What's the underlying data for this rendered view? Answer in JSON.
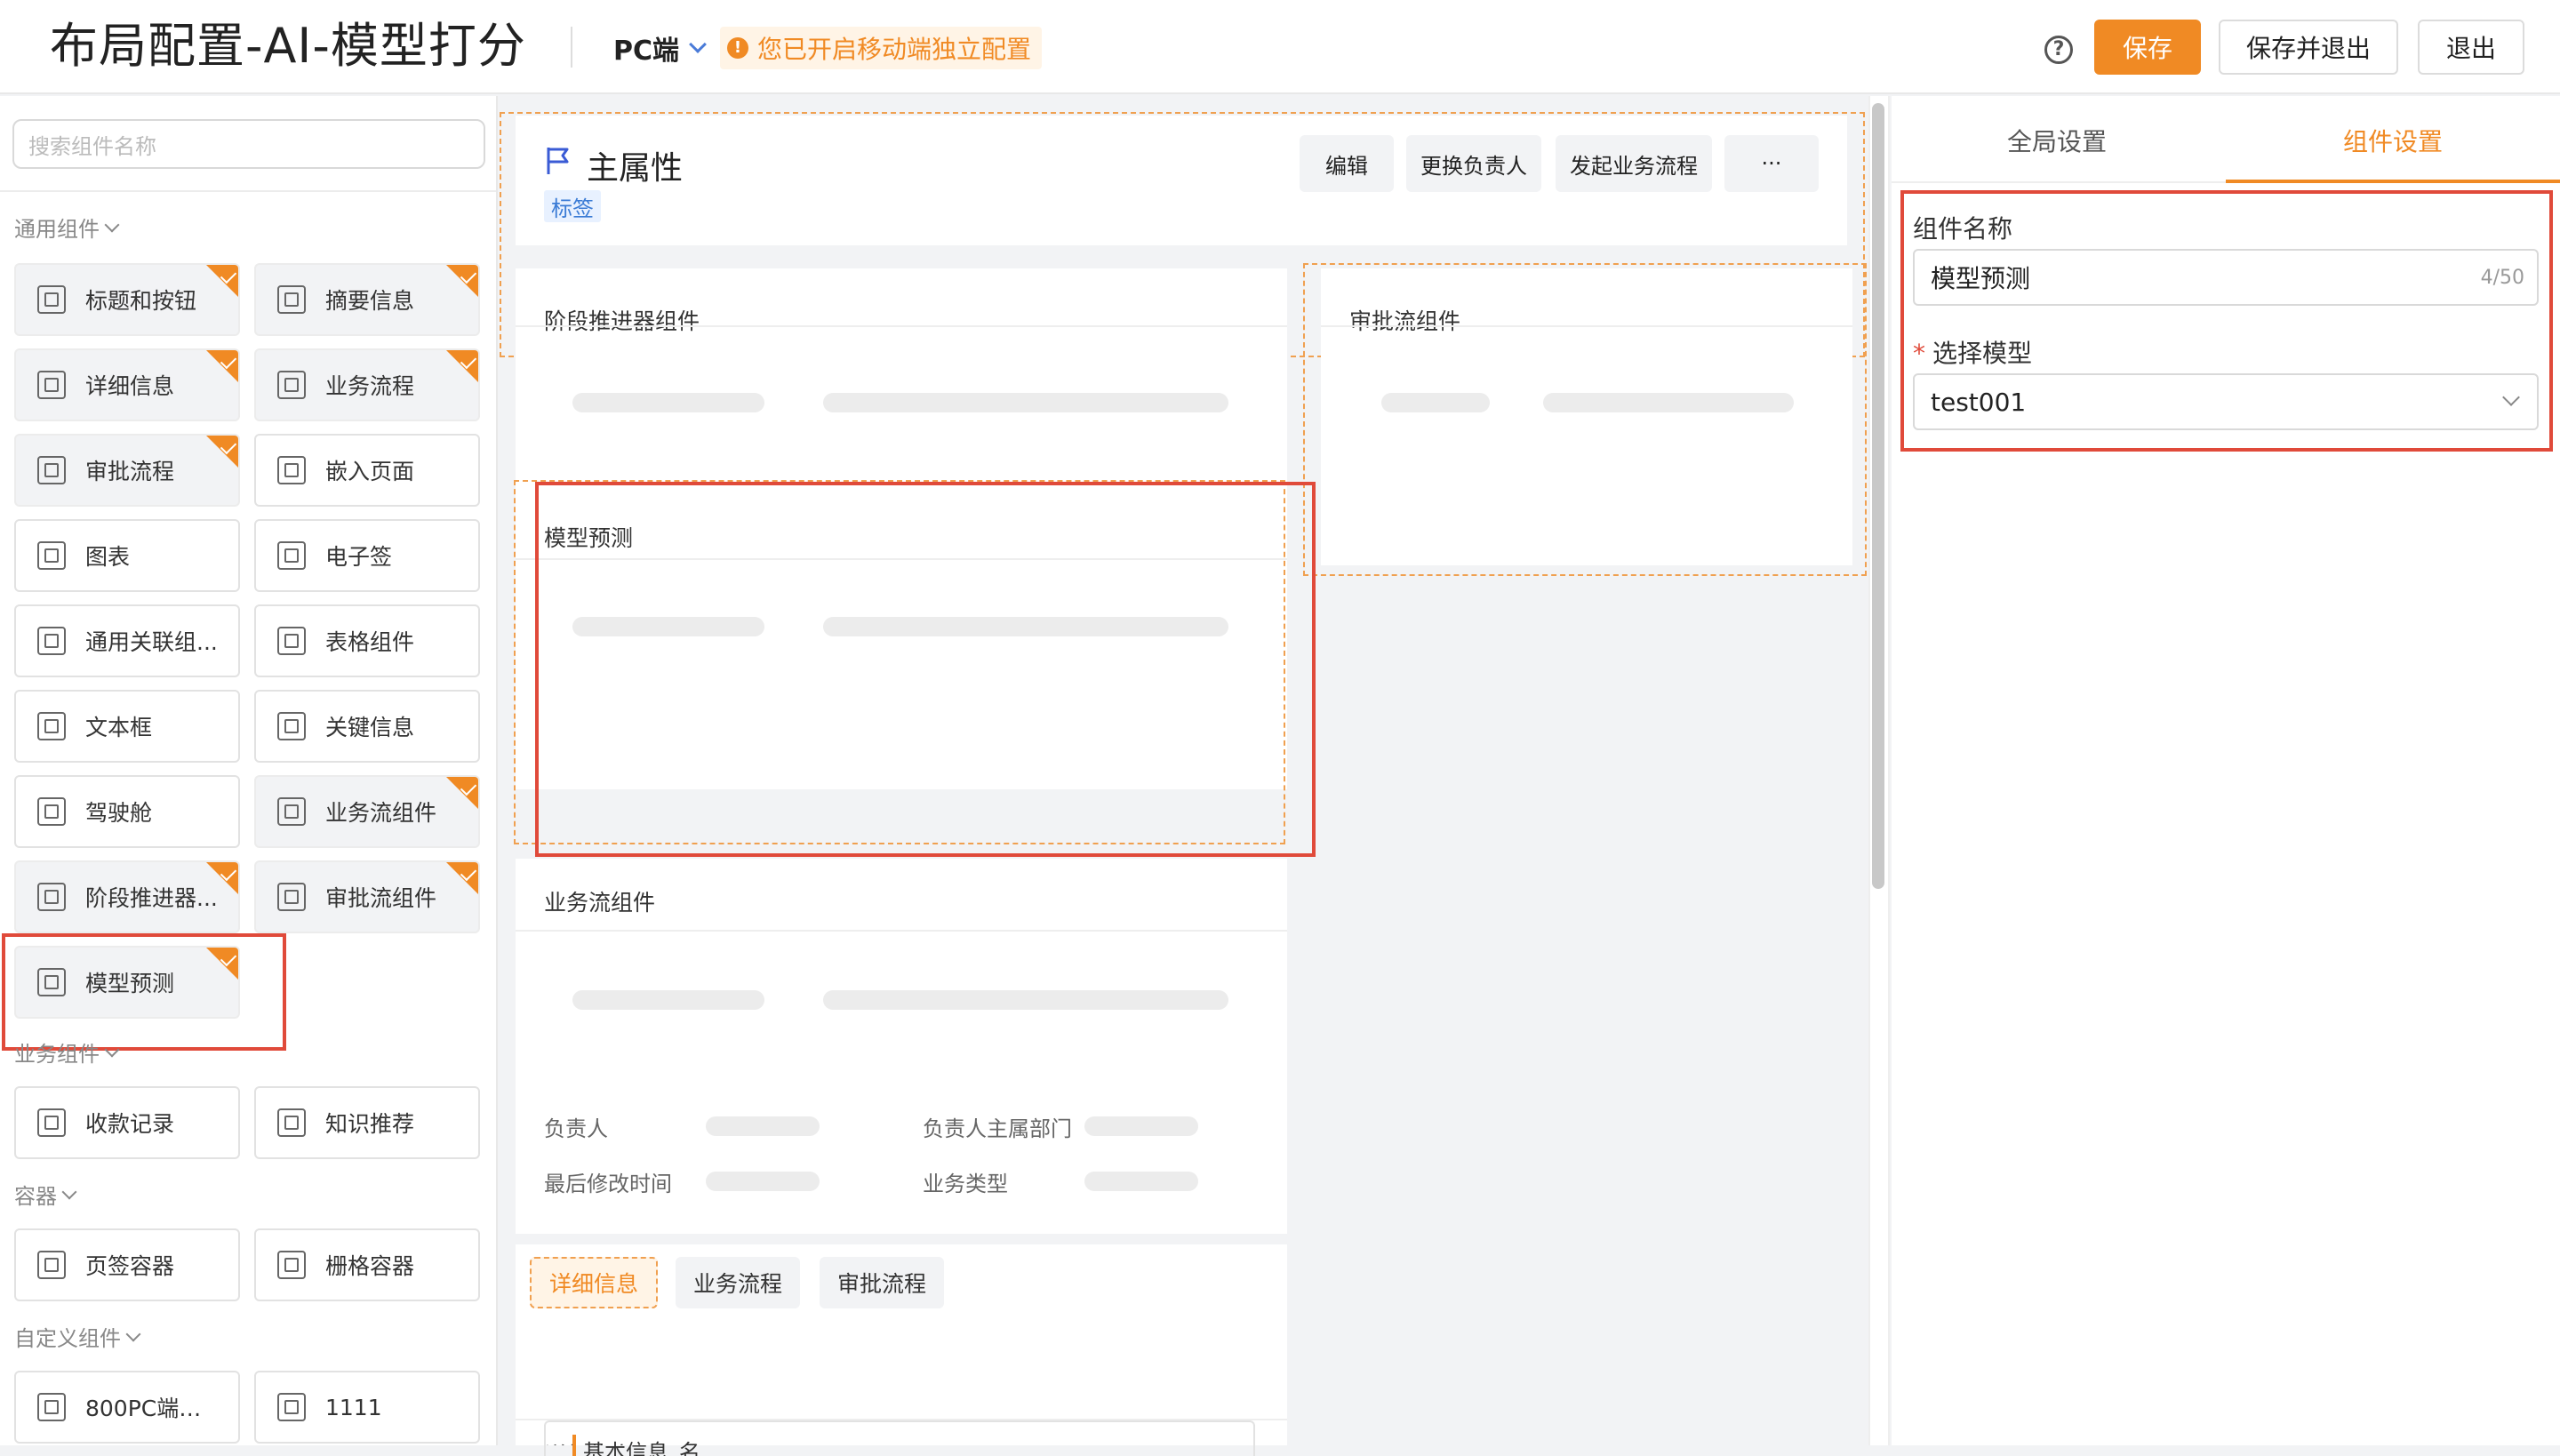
{
  "header": {
    "title": "布局配置-AI-模型打分",
    "device": "PC端",
    "notice": "您已开启移动端独立配置",
    "notice_icon": "!",
    "help_icon": "?",
    "save": "保存",
    "save_exit": "保存并退出",
    "exit": "退出"
  },
  "left": {
    "search_placeholder": "搜索组件名称",
    "groups": {
      "common": "通用组件",
      "business": "业务组件",
      "container": "容器",
      "custom": "自定义组件"
    },
    "common_items": [
      "标题和按钮",
      "摘要信息",
      "详细信息",
      "业务流程",
      "审批流程",
      "嵌入页面",
      "图表",
      "电子签",
      "通用关联组...",
      "表格组件",
      "文本框",
      "关键信息",
      "驾驶舱",
      "业务流组件",
      "阶段推进器...",
      "审批流组件",
      "模型预测"
    ],
    "business_items": [
      "收款记录",
      "知识推荐"
    ],
    "container_items": [
      "页签容器",
      "栅格容器"
    ],
    "custom_items": [
      "800PC端自...",
      "1111"
    ]
  },
  "canvas": {
    "main_title": "主属性",
    "tag": "标签",
    "actions": [
      "编辑",
      "更换负责人",
      "发起业务流程",
      "···"
    ],
    "stage_card": "阶段推进器组件",
    "approval_card": "审批流组件",
    "model_card": "模型预测",
    "bizflow_card": "业务流组件",
    "info_labels": [
      "负责人",
      "负责人主属部门",
      "最后修改时间",
      "业务类型"
    ],
    "tabs": [
      "详细信息",
      "业务流程",
      "审批流程"
    ],
    "detail_title": "详细信息",
    "basic_info": "基本信息_名"
  },
  "right": {
    "tab_global": "全局设置",
    "tab_component": "组件设置",
    "name_label": "组件名称",
    "name_value": "模型预测",
    "name_count": "4/50",
    "model_label": "选择模型",
    "model_required": "*",
    "model_value": "test001"
  },
  "colors": {
    "accent": "#f08a24",
    "highlight": "#e04a3a",
    "tag_blue": "#3a7bd5"
  }
}
